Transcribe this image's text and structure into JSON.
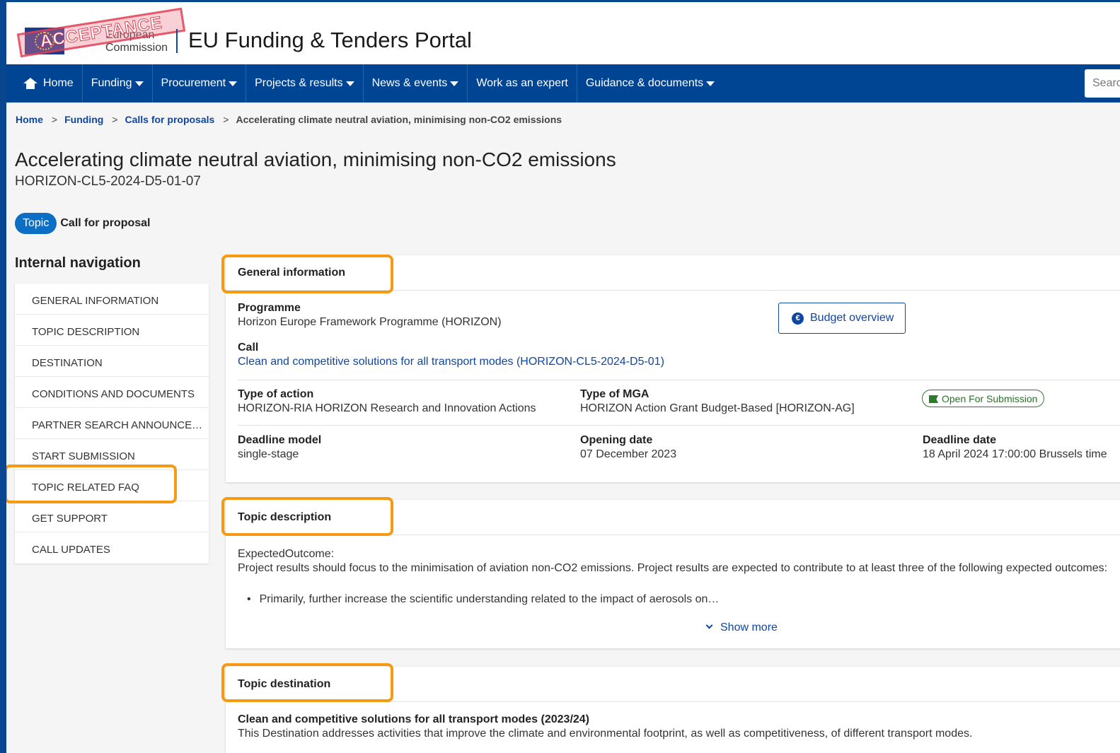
{
  "header": {
    "logo_text_line1": "European",
    "logo_text_line2": "Commission",
    "stamp_text": "ACCEPTANCE",
    "portal_title": "EU Funding & Tenders Portal"
  },
  "nav": {
    "home": "Home",
    "funding": "Funding",
    "procurement": "Procurement",
    "projects": "Projects & results",
    "news": "News & events",
    "expert": "Work as an expert",
    "guidance": "Guidance & documents",
    "search_placeholder": "Search"
  },
  "breadcrumb": {
    "home": "Home",
    "funding": "Funding",
    "calls": "Calls for proposals",
    "current": "Accelerating climate neutral aviation, minimising non-CO2 emissions"
  },
  "page": {
    "title": "Accelerating climate neutral aviation, minimising non-CO2 emissions",
    "code": "HORIZON-CL5-2024-D5-01-07",
    "badge": "Topic",
    "tag_label": "Call for proposal"
  },
  "internal_nav": {
    "title": "Internal navigation",
    "items": [
      "GENERAL INFORMATION",
      "TOPIC DESCRIPTION",
      "DESTINATION",
      "CONDITIONS AND DOCUMENTS",
      "PARTNER SEARCH ANNOUNCEMENTS",
      "START SUBMISSION",
      "TOPIC RELATED FAQ",
      "GET SUPPORT",
      "CALL UPDATES"
    ]
  },
  "general": {
    "heading": "General information",
    "programme_label": "Programme",
    "programme_value": "Horizon Europe Framework Programme (HORIZON)",
    "budget_button": "Budget overview",
    "call_label": "Call",
    "call_value": "Clean and competitive solutions for all transport modes (HORIZON-CL5-2024-D5-01)",
    "type_action_label": "Type of action",
    "type_action_value": "HORIZON-RIA HORIZON Research and Innovation Actions",
    "type_mga_label": "Type of MGA",
    "type_mga_value": "HORIZON Action Grant Budget-Based [HORIZON-AG]",
    "status": "Open For Submission",
    "deadline_model_label": "Deadline model",
    "deadline_model_value": "single-stage",
    "opening_label": "Opening date",
    "opening_value": "07 December 2023",
    "deadline_label": "Deadline date",
    "deadline_value": "18 April 2024 17:00:00 Brussels time"
  },
  "description": {
    "heading": "Topic description",
    "expected_label": "ExpectedOutcome:",
    "text": "Project results should focus to the minimisation of aviation non-CO2 emissions. Project results are expected to contribute to at least three of the following expected outcomes:",
    "bullet": "Primarily, further increase the scientific understanding related to the impact of aerosols on…",
    "show_more": "Show more"
  },
  "destination": {
    "heading": "Topic destination",
    "title": "Clean and competitive solutions for all transport modes (2023/24)",
    "text": "This Destination addresses activities that improve the climate and environmental footprint, as well as competitiveness, of different transport modes."
  }
}
